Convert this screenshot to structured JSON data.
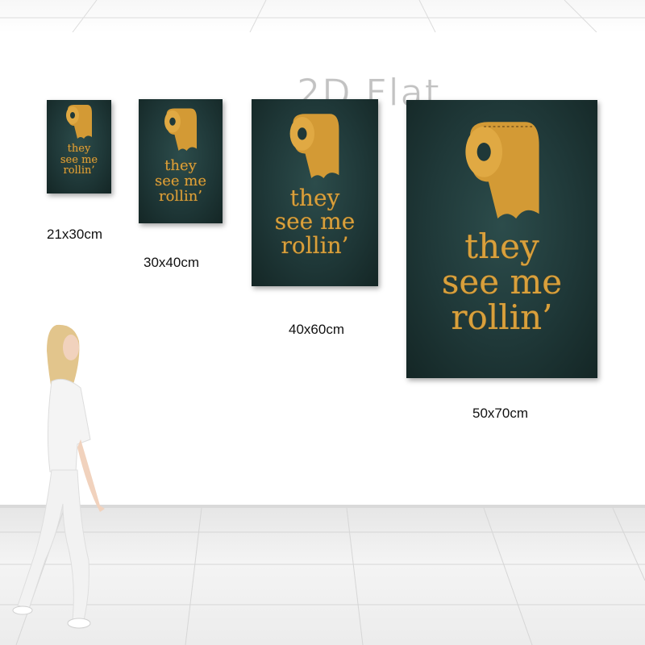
{
  "watermark": "2D Flat",
  "poster_text": {
    "line1": "they",
    "line2": "see me",
    "line3": "rollin’"
  },
  "sizes": [
    {
      "label": "21x30cm"
    },
    {
      "label": "30x40cm"
    },
    {
      "label": "40x60cm"
    },
    {
      "label": "50x70cm"
    }
  ],
  "colors": {
    "poster_background": "#1f3838",
    "gold": "#d9a03c"
  }
}
